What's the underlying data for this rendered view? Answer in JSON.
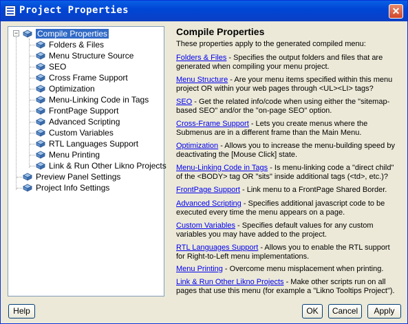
{
  "window": {
    "title": "Project Properties"
  },
  "tree": {
    "root": "Compile Properties",
    "children": [
      "Folders & Files",
      "Menu Structure Source",
      "SEO",
      "Cross Frame Support",
      "Optimization",
      "Menu-Linking Code in Tags",
      "FrontPage Support",
      "Advanced Scripting",
      "Custom Variables",
      "RTL Languages Support",
      "Menu Printing",
      "Link & Run Other Likno Projects"
    ],
    "siblings": [
      "Preview Panel Settings",
      "Project Info Settings"
    ]
  },
  "content": {
    "heading": "Compile Properties",
    "intro": "These properties apply to the generated compiled menu:",
    "items": [
      {
        "link": "Folders & Files",
        "text": " - Specifies the output folders and files that are generated when compiling your menu project."
      },
      {
        "link": "Menu Structure",
        "text": " - Are your menu items specified within this menu project OR within your web pages through <UL><LI> tags?"
      },
      {
        "link": "SEO",
        "text": " - Get the related info/code when using either the \"sitemap-based SEO\" and/or the \"on-page SEO\" option."
      },
      {
        "link": "Cross-Frame Support",
        "text": " - Lets you create menus where the Submenus are in a different frame than the Main Menu."
      },
      {
        "link": "Optimization",
        "text": " - Allows you to increase the menu-building speed by deactivating the [Mouse Click] state."
      },
      {
        "link": "Menu-Linking Code in Tags",
        "text": " - Is menu-linking code a \"direct child\" of the <BODY> tag OR \"sits\" inside additional tags (<td>, etc.)?"
      },
      {
        "link": "FrontPage Support",
        "text": " - Link menu to a FrontPage Shared Border."
      },
      {
        "link": "Advanced Scripting",
        "text": " - Specifies additional javascript code to be executed every time the menu appears on a page."
      },
      {
        "link": "Custom Variables",
        "text": " - Specifies default values for any custom variables you may have added to the project."
      },
      {
        "link": "RTL Languages Support",
        "text": " - Allows you to enable the RTL support for Right-to-Left menu implementations."
      },
      {
        "link": "Menu Printing",
        "text": " - Overcome menu misplacement when printing."
      },
      {
        "link": "Link & Run Other Likno Projects",
        "text": " - Make other scripts run on all pages that use this menu (for example a \"Likno Tooltips Project\")."
      }
    ]
  },
  "buttons": {
    "help": "Help",
    "ok": "OK",
    "cancel": "Cancel",
    "apply": "Apply"
  }
}
